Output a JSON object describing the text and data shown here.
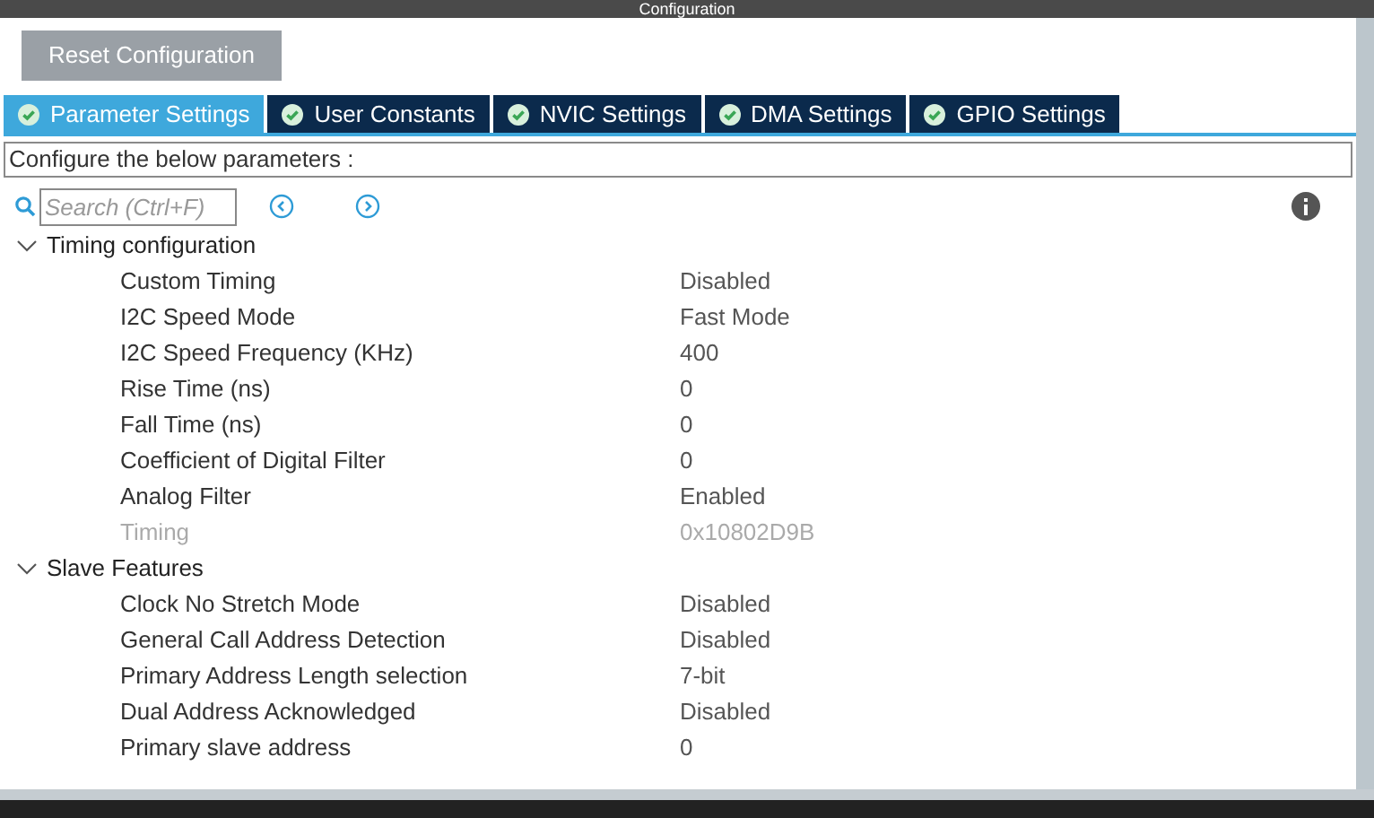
{
  "window": {
    "title": "Configuration"
  },
  "reset_button": "Reset Configuration",
  "tabs": [
    {
      "label": "Parameter Settings",
      "selected": true
    },
    {
      "label": "User Constants",
      "selected": false
    },
    {
      "label": "NVIC Settings",
      "selected": false
    },
    {
      "label": "DMA Settings",
      "selected": false
    },
    {
      "label": "GPIO Settings",
      "selected": false
    }
  ],
  "description": "Configure the below parameters :",
  "search": {
    "placeholder": "Search (Ctrl+F)"
  },
  "groups": [
    {
      "title": "Timing configuration",
      "expanded": true,
      "rows": [
        {
          "name": "Custom Timing",
          "value": "Disabled",
          "disabled": false
        },
        {
          "name": "I2C Speed Mode",
          "value": "Fast Mode",
          "disabled": false
        },
        {
          "name": "I2C Speed Frequency (KHz)",
          "value": "400",
          "disabled": false
        },
        {
          "name": "Rise Time (ns)",
          "value": "0",
          "disabled": false
        },
        {
          "name": "Fall Time (ns)",
          "value": "0",
          "disabled": false
        },
        {
          "name": "Coefficient of Digital Filter",
          "value": "0",
          "disabled": false
        },
        {
          "name": "Analog Filter",
          "value": "Enabled",
          "disabled": false
        },
        {
          "name": "Timing",
          "value": "0x10802D9B",
          "disabled": true
        }
      ]
    },
    {
      "title": "Slave Features",
      "expanded": true,
      "rows": [
        {
          "name": "Clock No Stretch Mode",
          "value": "Disabled",
          "disabled": false
        },
        {
          "name": "General Call Address Detection",
          "value": "Disabled",
          "disabled": false
        },
        {
          "name": "Primary Address Length selection",
          "value": "7-bit",
          "disabled": false
        },
        {
          "name": "Dual Address Acknowledged",
          "value": "Disabled",
          "disabled": false
        },
        {
          "name": "Primary slave address",
          "value": "0",
          "disabled": false
        }
      ]
    }
  ]
}
